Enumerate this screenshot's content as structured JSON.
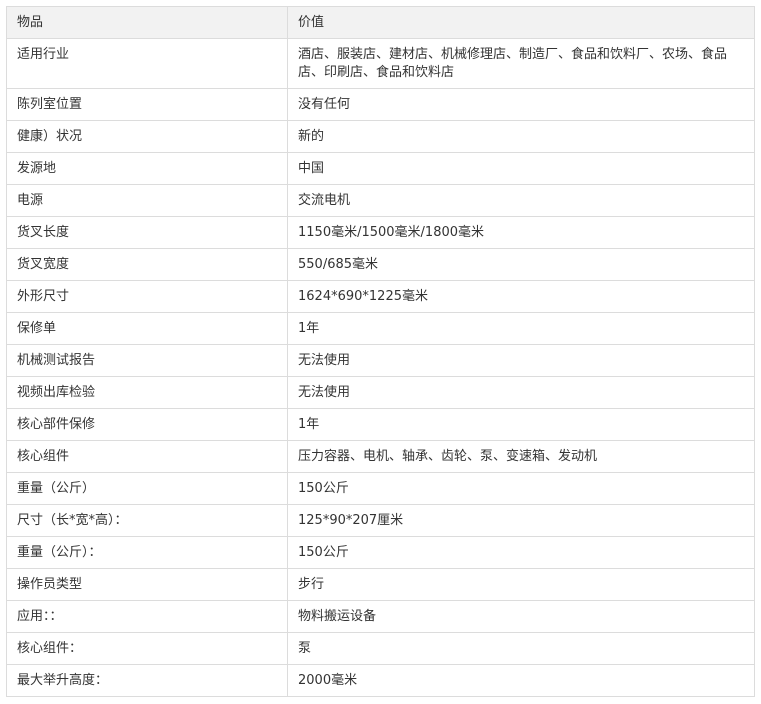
{
  "table": {
    "headers": [
      "物品",
      "价值"
    ],
    "rows": [
      [
        "适用行业",
        "酒店、服装店、建材店、机械修理店、制造厂、食品和饮料厂、农场、食品店、印刷店、食品和饮料店"
      ],
      [
        "陈列室位置",
        "没有任何"
      ],
      [
        "健康）状况",
        "新的"
      ],
      [
        "发源地",
        "中国"
      ],
      [
        "电源",
        "交流电机"
      ],
      [
        "货叉长度",
        "1150毫米/1500毫米/1800毫米"
      ],
      [
        "货叉宽度",
        "550/685毫米"
      ],
      [
        "外形尺寸",
        "1624*690*1225毫米"
      ],
      [
        "保修单",
        "1年"
      ],
      [
        "机械测试报告",
        "无法使用"
      ],
      [
        "视频出库检验",
        "无法使用"
      ],
      [
        "核心部件保修",
        "1年"
      ],
      [
        "核心组件",
        "压力容器、电机、轴承、齿轮、泵、变速箱、发动机"
      ],
      [
        "重量（公斤）",
        "150公斤"
      ],
      [
        "尺寸（长*宽*高）：",
        "125*90*207厘米"
      ],
      [
        "重量（公斤）：",
        "150公斤"
      ],
      [
        "操作员类型",
        "步行"
      ],
      [
        "应用：：",
        "物料搬运设备"
      ],
      [
        "核心组件：",
        "泵"
      ],
      [
        "最大举升高度：",
        "2000毫米"
      ]
    ]
  }
}
